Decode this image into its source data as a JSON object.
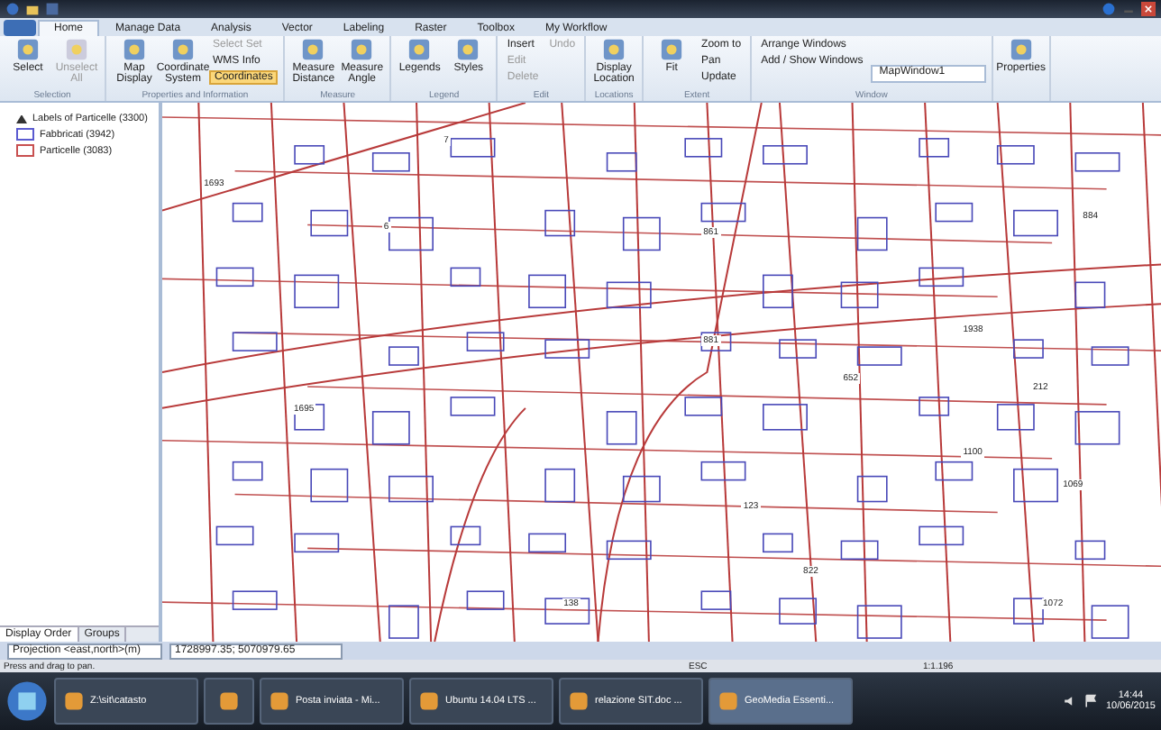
{
  "tabs": [
    {
      "label": "Home",
      "selected": true
    },
    {
      "label": "Manage Data",
      "selected": false
    },
    {
      "label": "Analysis",
      "selected": false
    },
    {
      "label": "Vector",
      "selected": false
    },
    {
      "label": "Labeling",
      "selected": false
    },
    {
      "label": "Raster",
      "selected": false
    },
    {
      "label": "Toolbox",
      "selected": false
    },
    {
      "label": "My Workflow",
      "selected": false
    }
  ],
  "ribbon": {
    "groups": [
      {
        "label": "Selection",
        "items": [
          {
            "kind": "large",
            "label": "Select",
            "disabled": false
          },
          {
            "kind": "large",
            "label": "Unselect All",
            "disabled": true
          }
        ]
      },
      {
        "label": "Properties and Information",
        "items": [
          {
            "kind": "large",
            "label": "Map Display",
            "disabled": false
          },
          {
            "kind": "large",
            "label": "Coordinate System",
            "disabled": false
          },
          {
            "kind": "stack",
            "entries": [
              {
                "label": "Select Set",
                "disabled": true,
                "selected": false
              },
              {
                "label": "WMS Info",
                "disabled": false,
                "selected": false
              },
              {
                "label": "Coordinates",
                "disabled": false,
                "selected": true
              }
            ]
          }
        ]
      },
      {
        "label": "Measure",
        "items": [
          {
            "kind": "large",
            "label": "Measure Distance",
            "disabled": false
          },
          {
            "kind": "large",
            "label": "Measure Angle",
            "disabled": false
          }
        ]
      },
      {
        "label": "Legend",
        "items": [
          {
            "kind": "large",
            "label": "Legends",
            "disabled": false
          },
          {
            "kind": "large",
            "label": "Styles",
            "disabled": false
          }
        ]
      },
      {
        "label": "Edit",
        "items": [
          {
            "kind": "stack",
            "entries": [
              {
                "label": "Insert",
                "disabled": false,
                "selected": false
              },
              {
                "label": "Edit",
                "disabled": true,
                "selected": false
              },
              {
                "label": "Delete",
                "disabled": true,
                "selected": false
              }
            ]
          },
          {
            "kind": "stack",
            "entries": [
              {
                "label": "Undo",
                "disabled": true,
                "selected": false
              }
            ]
          }
        ]
      },
      {
        "label": "Locations",
        "items": [
          {
            "kind": "large",
            "label": "Display Location",
            "disabled": false
          }
        ]
      },
      {
        "label": "Extent",
        "items": [
          {
            "kind": "large",
            "label": "Fit",
            "disabled": false
          },
          {
            "kind": "stack",
            "entries": [
              {
                "label": "Zoom to",
                "disabled": false,
                "selected": false
              },
              {
                "label": "Pan",
                "disabled": false,
                "selected": false
              },
              {
                "label": "Update",
                "disabled": false,
                "selected": false
              }
            ]
          }
        ]
      },
      {
        "label": "Window",
        "items": [
          {
            "kind": "stack",
            "entries": [
              {
                "label": "Arrange Windows",
                "disabled": false,
                "selected": false
              },
              {
                "label": "Add / Show Windows",
                "disabled": false,
                "selected": false
              }
            ]
          },
          {
            "kind": "combo",
            "value": "MapWindow1"
          }
        ]
      },
      {
        "items": [
          {
            "kind": "large",
            "label": "Properties",
            "disabled": false
          }
        ]
      }
    ]
  },
  "legend_panel": {
    "layers": [
      {
        "kind": "labels",
        "name": "Labels of Particelle (3300)"
      },
      {
        "kind": "area",
        "name": "Fabbricati (3942)",
        "color": "#5a5ad0"
      },
      {
        "kind": "area",
        "name": "Particelle (3083)",
        "color": "#c85050"
      }
    ],
    "tabs": [
      {
        "label": "Display Order",
        "selected": true
      },
      {
        "label": "Groups",
        "selected": false
      }
    ]
  },
  "map": {
    "labels": [
      "1693",
      "7",
      "6",
      "861",
      "1695",
      "1938",
      "881",
      "652",
      "123",
      "822",
      "1069",
      "1100",
      "1072",
      "212",
      "138",
      "884"
    ]
  },
  "coordinate_bar": {
    "projection": "Projection <east,north>(m)",
    "coordinates": "1728997.35; 5070979.65"
  },
  "status_bar": {
    "message": "Press and drag to pan.",
    "key": "ESC",
    "scale": "1:1.196"
  },
  "taskbar": {
    "items": [
      {
        "label": "Z:\\sit\\catasto",
        "selected": false
      },
      {
        "selected": false
      },
      {
        "label": "Posta inviata - Mi...",
        "selected": false
      },
      {
        "label": "Ubuntu 14.04 LTS ...",
        "selected": false
      },
      {
        "label": "relazione SIT.doc ...",
        "selected": false
      },
      {
        "label": "GeoMedia Essenti...",
        "selected": true
      }
    ],
    "time": "14:44",
    "date": "10/06/2015"
  }
}
